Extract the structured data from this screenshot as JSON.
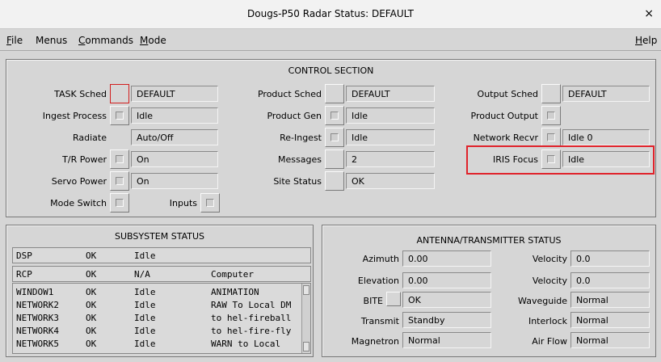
{
  "window": {
    "title": "Dougs-P50  Radar Status: DEFAULT",
    "close": "×"
  },
  "menu": {
    "file_first": "F",
    "file_rest": "ile",
    "menus": "Menus",
    "commands_first": "C",
    "commands_rest": "ommands",
    "mode_first": "M",
    "mode_rest": "ode",
    "help_first": "H",
    "help_rest": "elp"
  },
  "control": {
    "title": "CONTROL SECTION",
    "task_sched": {
      "label": "TASK Sched",
      "value": "DEFAULT"
    },
    "ingest_process": {
      "label": "Ingest Process",
      "value": "Idle"
    },
    "radiate": {
      "label": "Radiate",
      "value": "Auto/Off"
    },
    "tr_power": {
      "label": "T/R Power",
      "value": "On"
    },
    "servo_power": {
      "label": "Servo Power",
      "value": "On"
    },
    "mode_switch": {
      "label": "Mode Switch"
    },
    "inputs": {
      "label": "Inputs"
    },
    "product_sched": {
      "label": "Product Sched",
      "value": "DEFAULT"
    },
    "product_gen": {
      "label": "Product Gen",
      "value": "Idle"
    },
    "re_ingest": {
      "label": "Re-Ingest",
      "value": "Idle"
    },
    "messages": {
      "label": "Messages",
      "value": "2"
    },
    "site_status": {
      "label": "Site Status",
      "value": "OK"
    },
    "output_sched": {
      "label": "Output Sched",
      "value": "DEFAULT"
    },
    "product_output": {
      "label": "Product Output",
      "value": ""
    },
    "network_recvr": {
      "label": "Network Recvr",
      "value": "Idle  0"
    },
    "iris_focus": {
      "label": "IRIS Focus",
      "value": "Idle"
    }
  },
  "subsystem": {
    "title": "SUBSYSTEM STATUS",
    "rows": [
      {
        "name": "DSP",
        "status": "OK",
        "state": "Idle",
        "info": ""
      },
      {
        "name": "RCP",
        "status": "OK",
        "state": "N/A",
        "info": "Computer"
      }
    ],
    "list": [
      {
        "name": "WINDOW1",
        "status": "OK",
        "state": "Idle",
        "info": "ANIMATION"
      },
      {
        "name": "NETWORK2",
        "status": "OK",
        "state": "Idle",
        "info": "RAW To Local DM"
      },
      {
        "name": "NETWORK3",
        "status": "OK",
        "state": "Idle",
        "info": "to hel-fireball"
      },
      {
        "name": "NETWORK4",
        "status": "OK",
        "state": "Idle",
        "info": "to hel-fire-fly"
      },
      {
        "name": "NETWORK5",
        "status": "OK",
        "state": "Idle",
        "info": "WARN to Local"
      }
    ]
  },
  "antenna": {
    "title": "ANTENNA/TRANSMITTER STATUS",
    "azimuth": {
      "label": "Azimuth",
      "value": "0.00"
    },
    "elevation": {
      "label": "Elevation",
      "value": "0.00"
    },
    "bite": {
      "label": "BITE",
      "value": "OK"
    },
    "transmit": {
      "label": "Transmit",
      "value": "Standby"
    },
    "magnetron": {
      "label": "Magnetron",
      "value": "Normal"
    },
    "velocity1": {
      "label": "Velocity",
      "value": "0.0"
    },
    "velocity2": {
      "label": "Velocity",
      "value": "0.0"
    },
    "waveguide": {
      "label": "Waveguide",
      "value": "Normal"
    },
    "interlock": {
      "label": "Interlock",
      "value": "Normal"
    },
    "air_flow": {
      "label": "Air Flow",
      "value": "Normal"
    }
  }
}
